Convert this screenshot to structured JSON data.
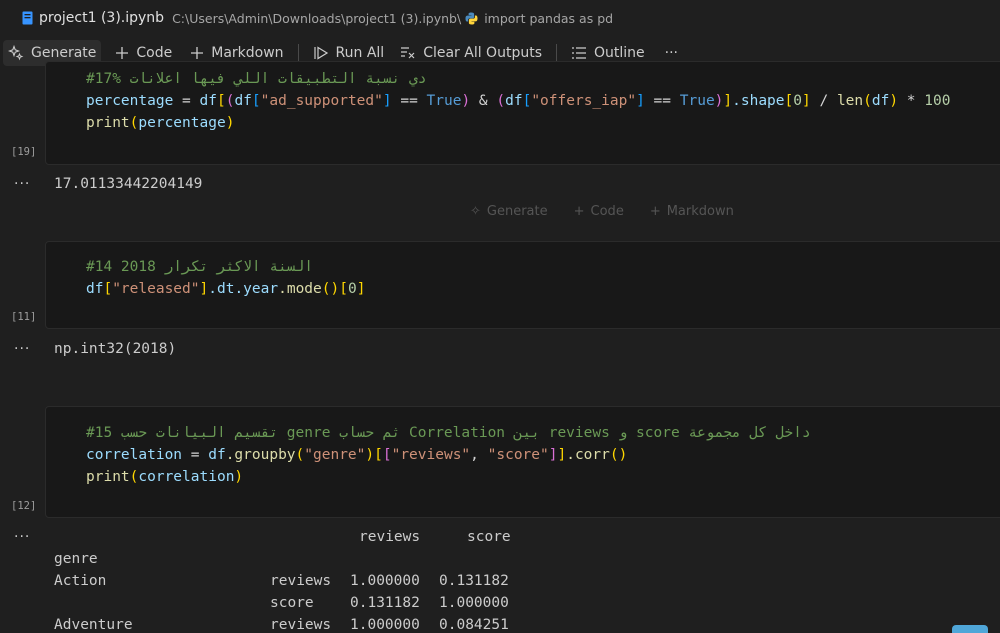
{
  "titlebar": {
    "filename": "project1 (3).ipynb",
    "path": "C:\\Users\\Admin\\Downloads\\project1 (3).ipynb\\",
    "symbol": "import pandas as pd",
    "file_icon": "notebook-file-icon",
    "symbol_icon": "python-icon"
  },
  "toolbar": {
    "generate": "Generate",
    "code": "Code",
    "markdown": "Markdown",
    "run_all": "Run All",
    "clear_outputs": "Clear All Outputs",
    "outline": "Outline",
    "more": "···"
  },
  "insert_bar": {
    "generate": "Generate",
    "code": "Code",
    "markdown": "Markdown"
  },
  "cells": [
    {
      "exec_count": "[19]",
      "comment": "#17% دي نسبة التطبيقات اللي فيها اعلانات",
      "output": "17.01133442204149",
      "tokens": {
        "percentage": "percentage",
        "eq": " = ",
        "df": "df",
        "ad_supported": "\"ad_supported\"",
        "eqeq": " == ",
        "true": "True",
        "amp": " & ",
        "offers_iap": "\"offers_iap\"",
        "shape": ".shape",
        "zero": "0",
        "div": " / ",
        "len": "len",
        "mul": " * ",
        "hundred": "100",
        "print": "print"
      }
    },
    {
      "exec_count": "[11]",
      "comment": "#14 2018 السنة الاكثر تكرار",
      "output": "np.int32(2018)",
      "tokens": {
        "df": "df",
        "released": "\"released\"",
        "dt": ".dt",
        "year": ".year",
        "mode": ".mode",
        "zero": "0"
      }
    },
    {
      "exec_count": "[12]",
      "comment": "#15 تقسيم البيانات حسب genre ثم حساب Correlation بين reviews و score داخل كل مجموعة",
      "tokens": {
        "correlation": "correlation",
        "eq": " = ",
        "df": "df",
        "groupby": ".groupby",
        "genre": "\"genre\"",
        "reviews": "\"reviews\"",
        "comma": ", ",
        "score": "\"score\"",
        "corr": ".corr",
        "print": "print"
      },
      "output_table": {
        "columns": [
          "reviews",
          "score"
        ],
        "index_name": "genre",
        "rows": [
          {
            "group": "Action",
            "var": "reviews",
            "reviews": "1.000000",
            "score": "0.131182"
          },
          {
            "group": "",
            "var": "score",
            "reviews": "0.131182",
            "score": "1.000000"
          },
          {
            "group": "Adventure",
            "var": "reviews",
            "reviews": "1.000000",
            "score": "0.084251"
          }
        ]
      }
    }
  ],
  "colors": {
    "background": "#1f1f1f",
    "cell_bg": "#181818",
    "comment": "#6a9955",
    "function": "#dcdcaa",
    "variable": "#9cdcfe",
    "string": "#ce9178",
    "keyword": "#569cd6",
    "number": "#b5cea8",
    "accent": "#4fa6d8"
  }
}
